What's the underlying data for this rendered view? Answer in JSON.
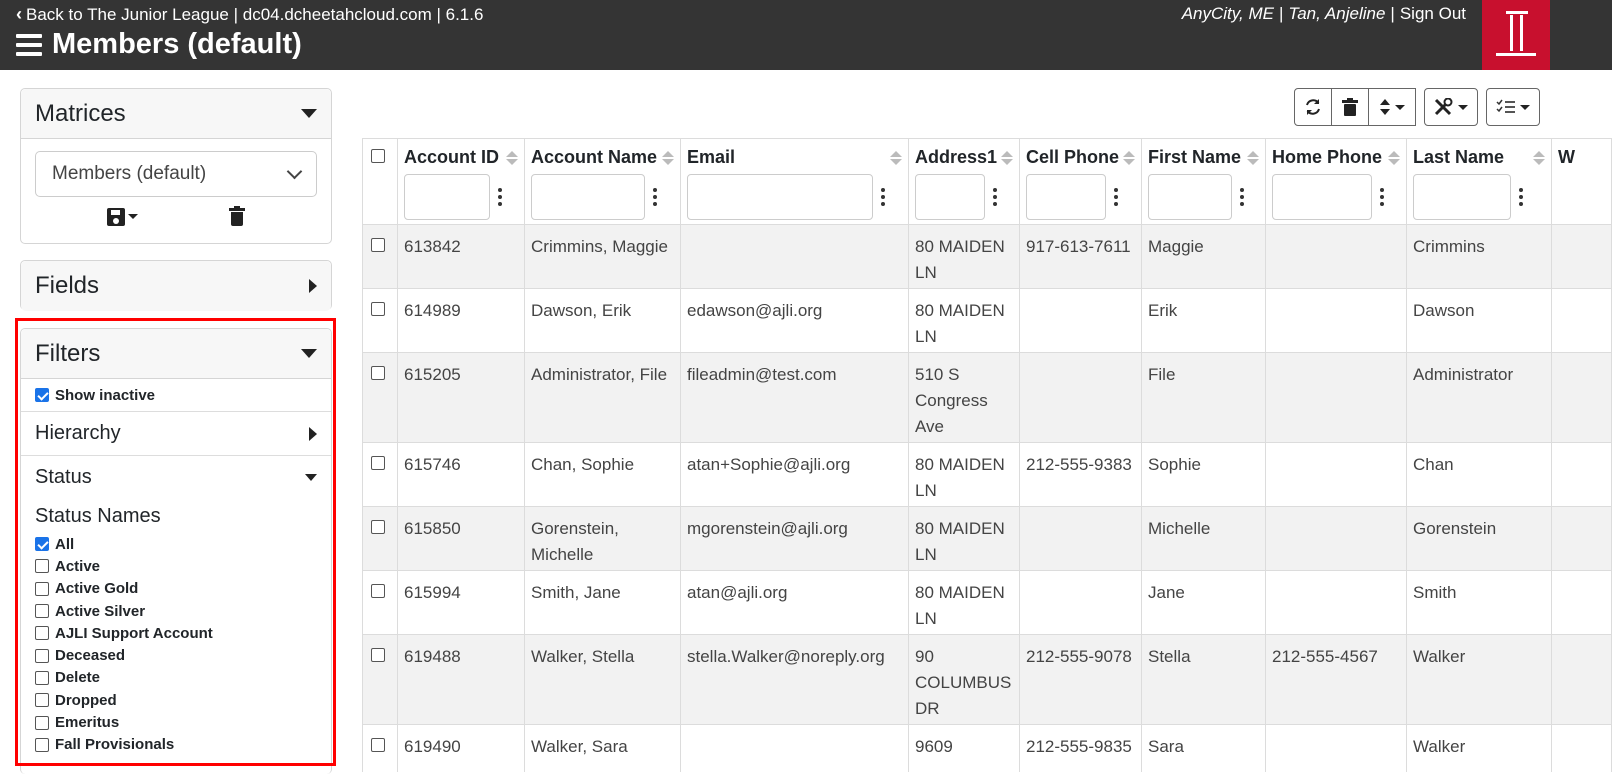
{
  "header": {
    "back_label": "Back to The Junior League | dc04.dcheetahcloud.com | 6.1.6",
    "title": "Members (default)",
    "location": "AnyCity, ME",
    "user": "Tan, Anjeline",
    "sign_out": "Sign Out",
    "logo_text": "JL",
    "colors": {
      "bar": "#343434",
      "logo": "#c8102e"
    }
  },
  "sidebar": {
    "matrices": {
      "title": "Matrices",
      "selected": "Members (default)"
    },
    "fields": {
      "title": "Fields"
    },
    "filters": {
      "title": "Filters",
      "show_inactive": {
        "label": "Show inactive",
        "checked": true
      },
      "hierarchy": "Hierarchy",
      "status": "Status",
      "status_names_title": "Status Names",
      "status_options": [
        {
          "label": "All",
          "checked": true
        },
        {
          "label": "Active",
          "checked": false
        },
        {
          "label": "Active Gold",
          "checked": false
        },
        {
          "label": "Active Silver",
          "checked": false
        },
        {
          "label": "AJLI Support Account",
          "checked": false
        },
        {
          "label": "Deceased",
          "checked": false
        },
        {
          "label": "Delete",
          "checked": false
        },
        {
          "label": "Dropped",
          "checked": false
        },
        {
          "label": "Emeritus",
          "checked": false
        },
        {
          "label": "Fall Provisionals",
          "checked": false
        }
      ]
    }
  },
  "toolbar": {
    "buttons": [
      "refresh-icon",
      "trash-icon",
      "sort-icon",
      "tools-icon",
      "list-check-icon"
    ]
  },
  "table": {
    "columns": [
      "Account ID",
      "Account Name",
      "Email",
      "Address1",
      "Cell Phone",
      "First Name",
      "Home Phone",
      "Last Name",
      "W"
    ],
    "rows": [
      [
        "613842",
        "Crimmins, Maggie",
        "",
        "80 MAIDEN LN",
        "917-613-7611",
        "Maggie",
        "",
        "Crimmins"
      ],
      [
        "614989",
        "Dawson, Erik",
        "edawson@ajli.org",
        "80 MAIDEN LN",
        "",
        "Erik",
        "",
        "Dawson"
      ],
      [
        "615205",
        "Administrator, File",
        "fileadmin@test.com",
        "510 S Congress Ave",
        "",
        "File",
        "",
        "Administrator"
      ],
      [
        "615746",
        "Chan, Sophie",
        "atan+Sophie@ajli.org",
        "80 MAIDEN LN",
        "212-555-9383",
        "Sophie",
        "",
        "Chan"
      ],
      [
        "615850",
        "Gorenstein, Michelle",
        "mgorenstein@ajli.org",
        "80 MAIDEN LN",
        "",
        "Michelle",
        "",
        "Gorenstein"
      ],
      [
        "615994",
        "Smith, Jane",
        "atan@ajli.org",
        "80 MAIDEN LN",
        "",
        "Jane",
        "",
        "Smith"
      ],
      [
        "619488",
        "Walker, Stella",
        "stella.Walker@noreply.org",
        "90 COLUMBUS DR",
        "212-555-9078",
        "Stella",
        "212-555-4567",
        "Walker"
      ],
      [
        "619490",
        "Walker, Sara",
        "",
        "9609",
        "212-555-9835",
        "Sara",
        "",
        "Walker"
      ]
    ]
  }
}
